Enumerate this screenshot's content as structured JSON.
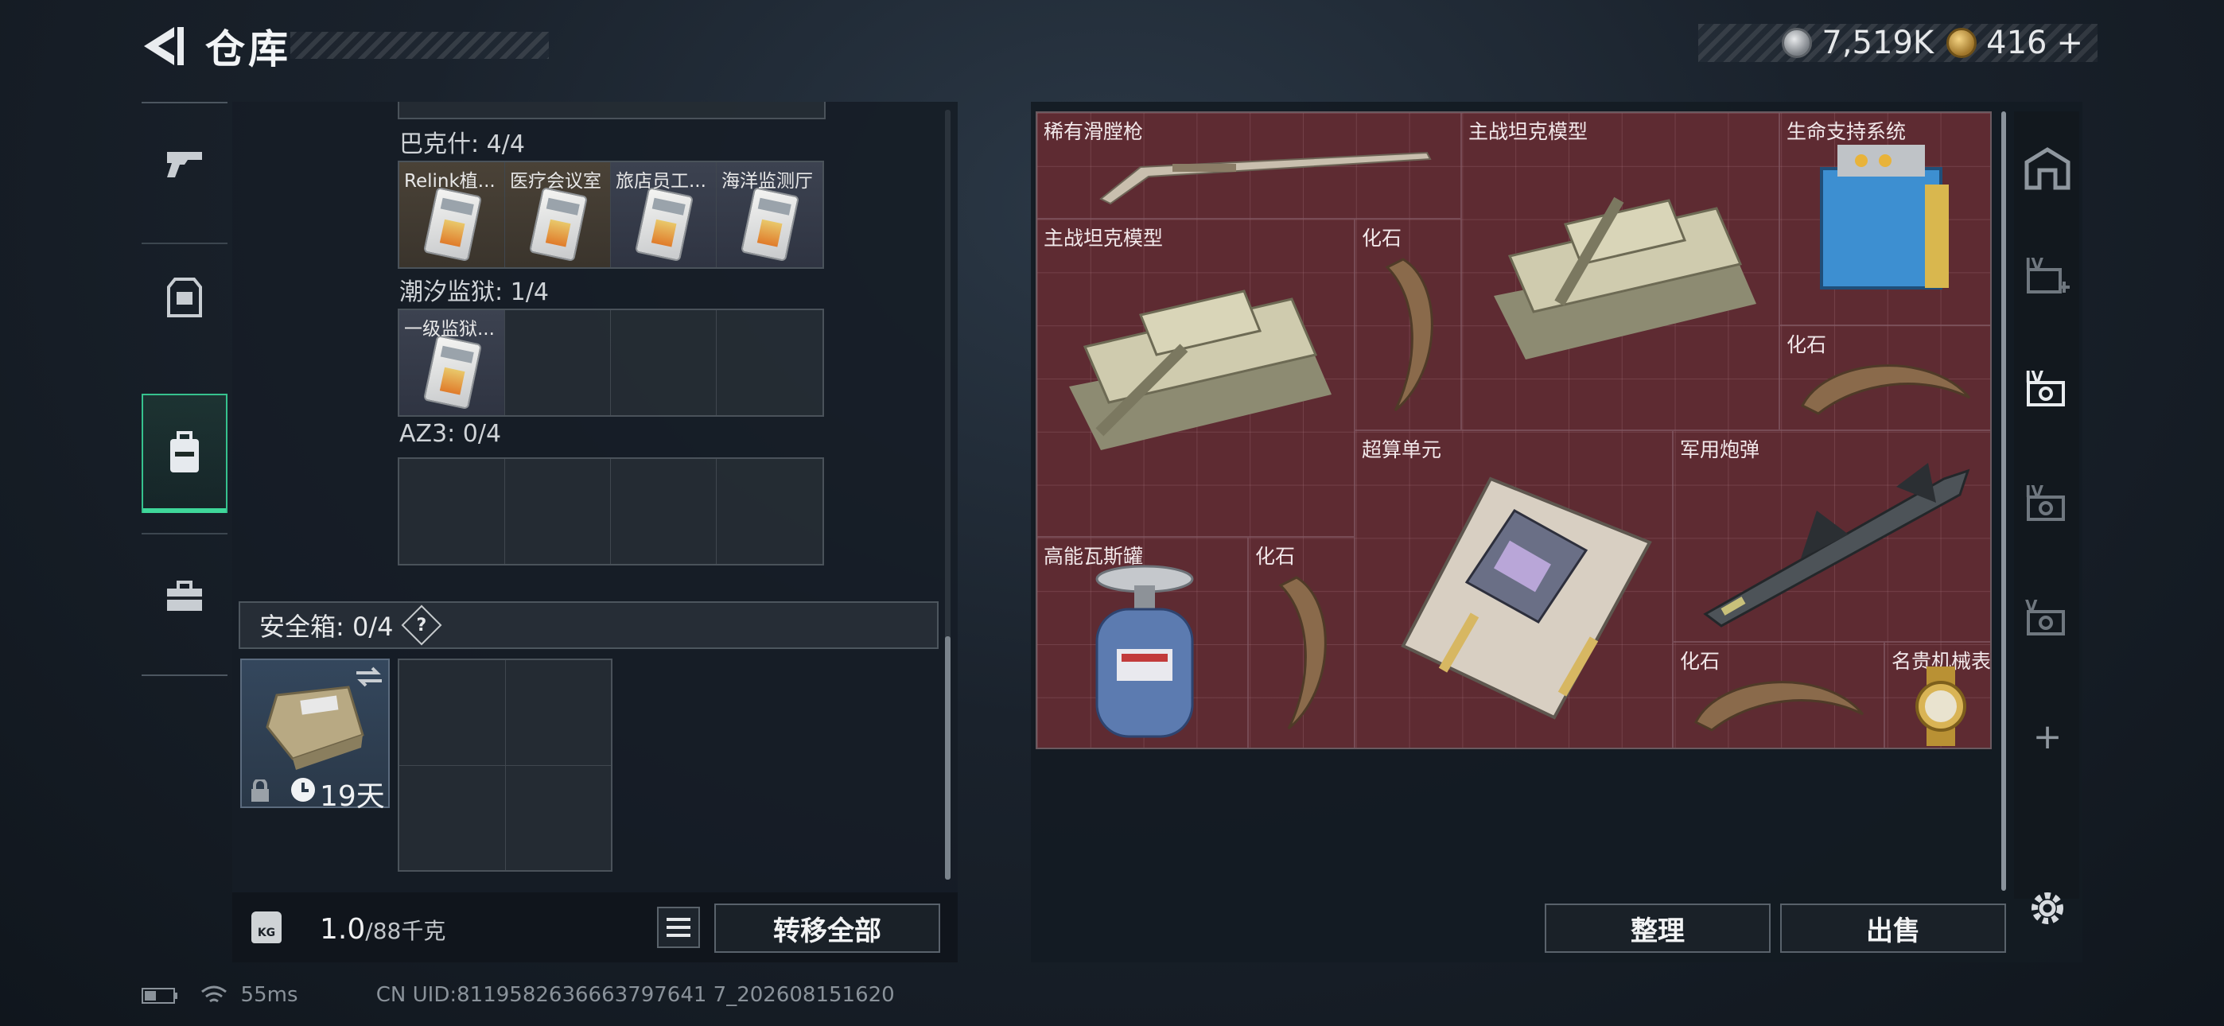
{
  "header": {
    "title": "仓库",
    "silver_amount": "7,519K",
    "gold_amount": "416",
    "gold_add": "+"
  },
  "nav": {
    "items": [
      "weapons",
      "armor",
      "backpack",
      "toolbox"
    ],
    "active_index": 2
  },
  "left": {
    "sections": [
      {
        "label": "巴克什: 4/4",
        "cells": [
          "Relink植...",
          "医疗会议室",
          "旅店员工...",
          "海洋监测厅"
        ]
      },
      {
        "label": "潮汐监狱: 1/4",
        "cells": [
          "一级监狱...",
          "",
          "",
          ""
        ]
      },
      {
        "label": "AZ3: 0/4",
        "cells": [
          "",
          "",
          "",
          ""
        ]
      }
    ],
    "safe_box": {
      "label": "安全箱: 0/4",
      "help": "?",
      "timer": "19天"
    },
    "weight": {
      "current": "1.0",
      "max": "/88千克",
      "kg_label": "KG"
    },
    "transfer_all": "转移全部"
  },
  "stash": {
    "items": [
      {
        "name": "稀有滑膛枪"
      },
      {
        "name": "主战坦克模型"
      },
      {
        "name": "生命支持系统"
      },
      {
        "name": "主战坦克模型"
      },
      {
        "name": "化石"
      },
      {
        "name": "化石"
      },
      {
        "name": "超算单元"
      },
      {
        "name": "军用炮弹"
      },
      {
        "name": "高能瓦斯罐"
      },
      {
        "name": "化石"
      },
      {
        "name": "化石"
      },
      {
        "name": "名贵机械表"
      }
    ],
    "sort_label": "整理",
    "sell_label": "出售"
  },
  "right_tabs": {
    "labels": [
      "IV",
      "IV",
      "IV",
      "V"
    ],
    "add": "+"
  },
  "status_bar": {
    "ping": "55ms",
    "uid": "CN UID:8119582636663797641 7_202608151620"
  },
  "colors": {
    "accent": "#3fd79a",
    "stash_bg": "#5e2b32"
  }
}
